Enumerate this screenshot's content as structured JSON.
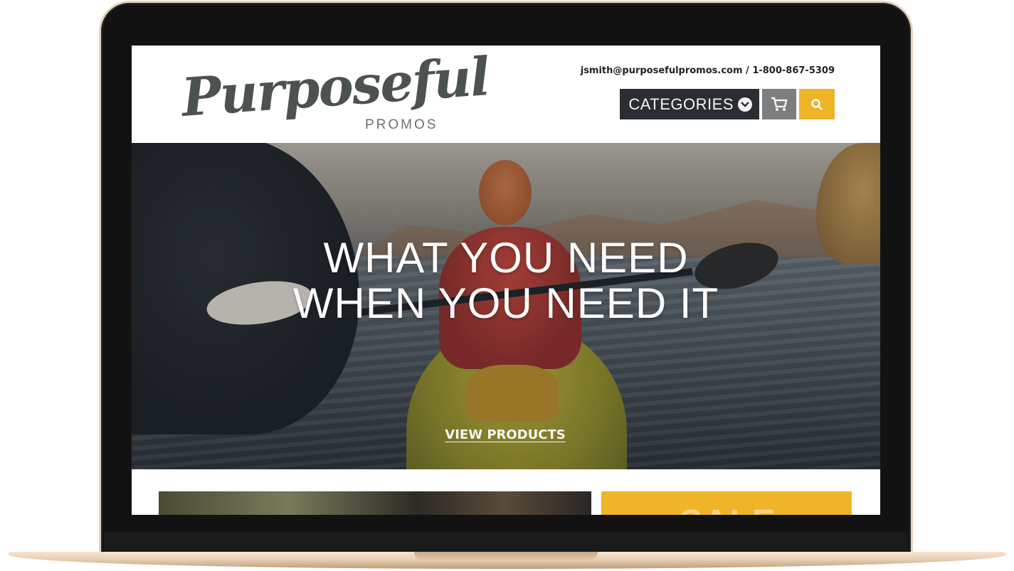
{
  "brand": {
    "logo_script": "Purposeful",
    "logo_sub": "PROMOS"
  },
  "header": {
    "contact": "jsmith@purposefulpromos.com / 1-800-867-5309",
    "categories_label": "CATEGORIES",
    "categories_icon": "chevron-down-circle-icon",
    "cart_icon": "cart-icon",
    "search_icon": "search-icon",
    "colors": {
      "dark_button": "#2a2e33",
      "cart_button": "#7b7d7e",
      "accent": "#f0b429"
    }
  },
  "hero": {
    "title_line1": "WHAT YOU NEED",
    "title_line2": "WHEN YOU NEED IT",
    "cta_label": "VIEW PRODUCTS"
  },
  "promo": {
    "sale_text": "SALE"
  }
}
